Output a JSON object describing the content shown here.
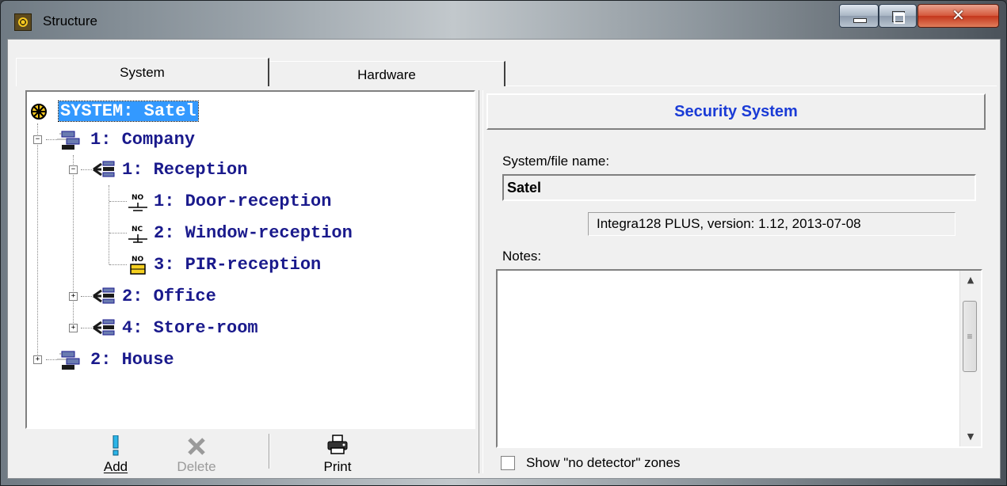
{
  "window": {
    "title": "Structure"
  },
  "tabs": [
    {
      "label": "System"
    },
    {
      "label": "Hardware"
    }
  ],
  "tree": {
    "root": "SYSTEM: Satel",
    "nodes": [
      {
        "label": "1: Company",
        "icon": "object-icon"
      },
      {
        "label": "1: Reception",
        "icon": "partition-icon"
      },
      {
        "label": "1: Door-reception",
        "icon": "no-zone-icon",
        "tag": "NO"
      },
      {
        "label": "2: Window-reception",
        "icon": "nc-zone-icon",
        "tag": "NC"
      },
      {
        "label": "3: PIR-reception",
        "icon": "pir-zone-icon",
        "tag": "NO"
      },
      {
        "label": "2: Office",
        "icon": "partition-icon"
      },
      {
        "label": "4: Store-room",
        "icon": "partition-icon"
      },
      {
        "label": "2: House",
        "icon": "object-icon"
      }
    ]
  },
  "toolbar": {
    "add_label": "Add",
    "delete_label": "Delete",
    "print_label": "Print"
  },
  "details": {
    "header": "Security System",
    "sysname_label": "System/file name:",
    "sysname_value": "Satel",
    "version": "Integra128 PLUS, version: 1.12,   2013-07-08",
    "notes_label": "Notes:",
    "notes_value": "",
    "show_zones_label": "Show \"no detector\" zones",
    "show_zones_checked": false
  },
  "colors": {
    "tree_text": "#1a1a8c",
    "selection": "#3399ff",
    "header_text": "#1a3bd6"
  }
}
